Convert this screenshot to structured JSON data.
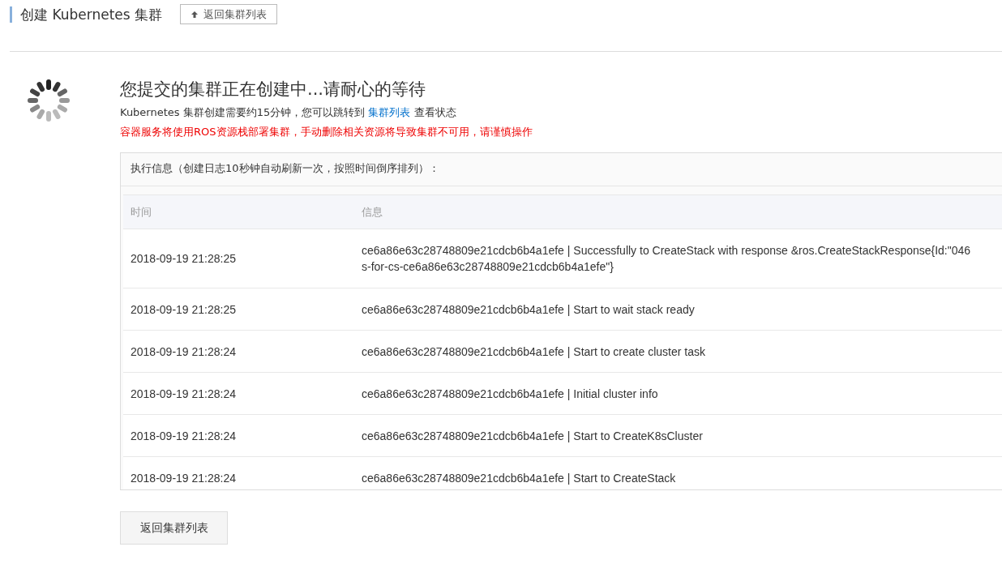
{
  "header": {
    "title": "创建 Kubernetes 集群",
    "back_button": "返回集群列表"
  },
  "status": {
    "heading": "您提交的集群正在创建中...请耐心的等待",
    "info_before": "Kubernetes 集群创建需要约15分钟，您可以跳转到",
    "info_link": "集群列表",
    "info_after": "查看状态",
    "warning": "容器服务将使用ROS资源栈部署集群，手动删除相关资源将导致集群不可用，请谨慎操作"
  },
  "log_panel": {
    "title": "执行信息（创建日志10秒钟自动刷新一次，按照时间倒序排列）：",
    "columns": [
      "时间",
      "信息"
    ],
    "rows": [
      {
        "time": "2018-09-19 21:28:25",
        "message": [
          "ce6a86e63c28748809e21cdcb6b4a1efe | Successfully to CreateStack with response &ros.CreateStackResponse{Id:\"046",
          "s-for-cs-ce6a86e63c28748809e21cdcb6b4a1efe\"}"
        ]
      },
      {
        "time": "2018-09-19 21:28:25",
        "message": [
          "ce6a86e63c28748809e21cdcb6b4a1efe | Start to wait stack ready"
        ]
      },
      {
        "time": "2018-09-19 21:28:24",
        "message": [
          "ce6a86e63c28748809e21cdcb6b4a1efe | Start to create cluster task"
        ]
      },
      {
        "time": "2018-09-19 21:28:24",
        "message": [
          "ce6a86e63c28748809e21cdcb6b4a1efe | Initial cluster info"
        ]
      },
      {
        "time": "2018-09-19 21:28:24",
        "message": [
          "ce6a86e63c28748809e21cdcb6b4a1efe | Start to CreateK8sCluster"
        ]
      },
      {
        "time": "2018-09-19 21:28:24",
        "message": [
          "ce6a86e63c28748809e21cdcb6b4a1efe | Start to CreateStack"
        ]
      }
    ]
  },
  "footer_button": "返回集群列表"
}
